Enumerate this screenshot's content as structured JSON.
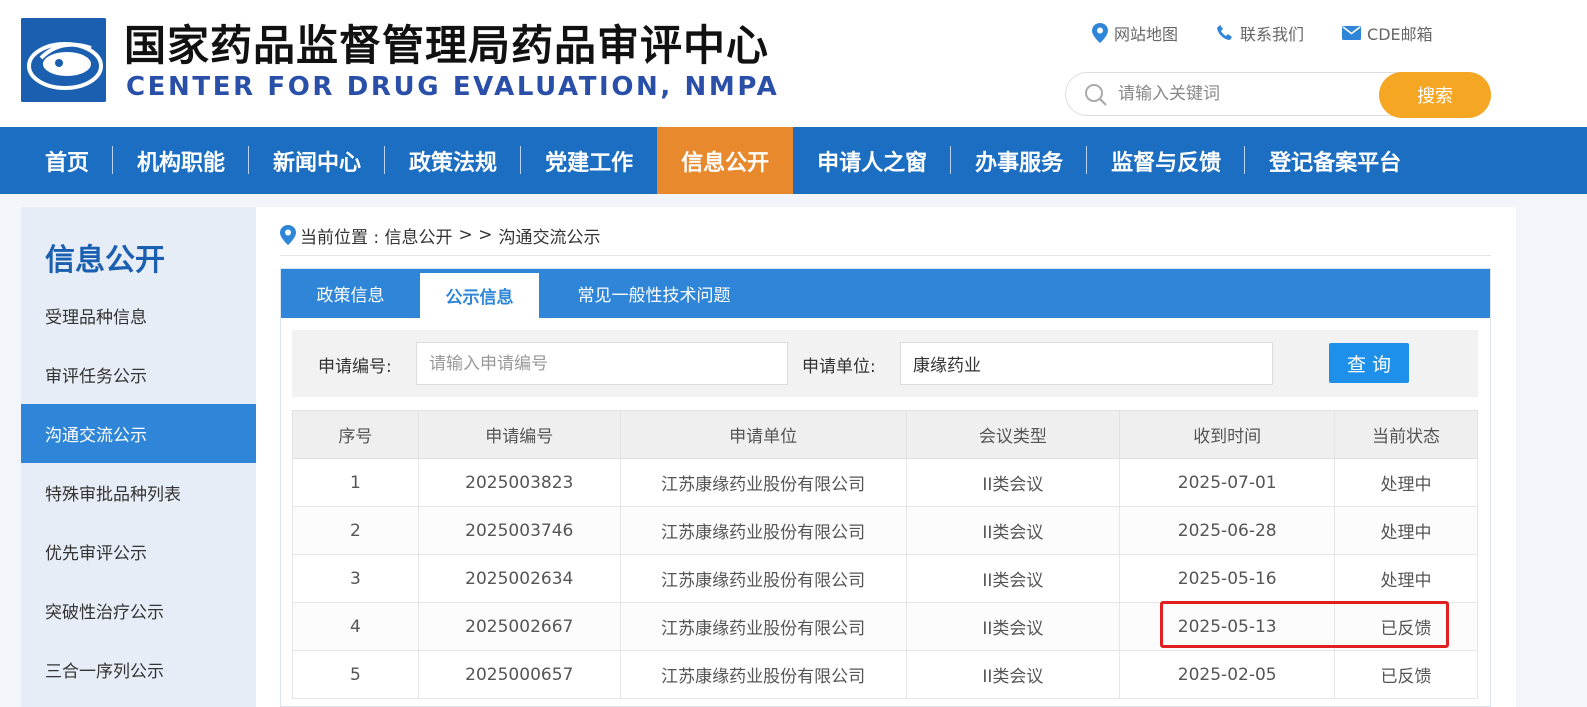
{
  "header": {
    "title": "国家药品监督管理局药品审评中心",
    "subtitle": "CENTER FOR DRUG EVALUATION, NMPA",
    "links": [
      {
        "label": "网站地图",
        "icon": "map-pin-icon"
      },
      {
        "label": "联系我们",
        "icon": "phone-icon"
      },
      {
        "label": "CDE邮箱",
        "icon": "mail-icon"
      }
    ],
    "search": {
      "placeholder": "请输入关键词",
      "button": "搜索"
    }
  },
  "nav": {
    "items": [
      "首页",
      "机构职能",
      "新闻中心",
      "政策法规",
      "党建工作",
      "信息公开",
      "申请人之窗",
      "办事服务",
      "监督与反馈",
      "登记备案平台"
    ],
    "active": "信息公开"
  },
  "sidebar": {
    "title": "信息公开",
    "items": [
      "受理品种信息",
      "审评任务公示",
      "沟通交流公示",
      "特殊审批品种列表",
      "优先审评公示",
      "突破性治疗公示",
      "三合一序列公示"
    ],
    "active": "沟通交流公示"
  },
  "breadcrumb": {
    "prefix": "当前位置 : 信息公开",
    "separator": "> >",
    "current": "沟通交流公示"
  },
  "tabs": [
    "政策信息",
    "公示信息",
    "常见一般性技术问题"
  ],
  "filter": {
    "app_no_label": "申请编号:",
    "app_no_placeholder": "请输入申请编号",
    "app_no_value": "",
    "unit_label": "申请单位:",
    "unit_value": "康缘药业",
    "query_button": "查 询"
  },
  "table": {
    "headers": [
      "序号",
      "申请编号",
      "申请单位",
      "会议类型",
      "收到时间",
      "当前状态"
    ],
    "rows": [
      [
        "1",
        "2025003823",
        "江苏康缘药业股份有限公司",
        "II类会议",
        "2025-07-01",
        "处理中"
      ],
      [
        "2",
        "2025003746",
        "江苏康缘药业股份有限公司",
        "II类会议",
        "2025-06-28",
        "处理中"
      ],
      [
        "3",
        "2025002634",
        "江苏康缘药业股份有限公司",
        "II类会议",
        "2025-05-16",
        "处理中"
      ],
      [
        "4",
        "2025002667",
        "江苏康缘药业股份有限公司",
        "II类会议",
        "2025-05-13",
        "已反馈"
      ],
      [
        "5",
        "2025000657",
        "江苏康缘药业股份有限公司",
        "II类会议",
        "2025-02-05",
        "已反馈"
      ]
    ]
  },
  "colors": {
    "nav_bg": "#1b6ec2",
    "nav_active": "#e8892e",
    "accent_blue": "#2f86d8",
    "search_button": "#f5a623",
    "query_button": "#1e90ea",
    "highlight_red": "#e02020"
  }
}
